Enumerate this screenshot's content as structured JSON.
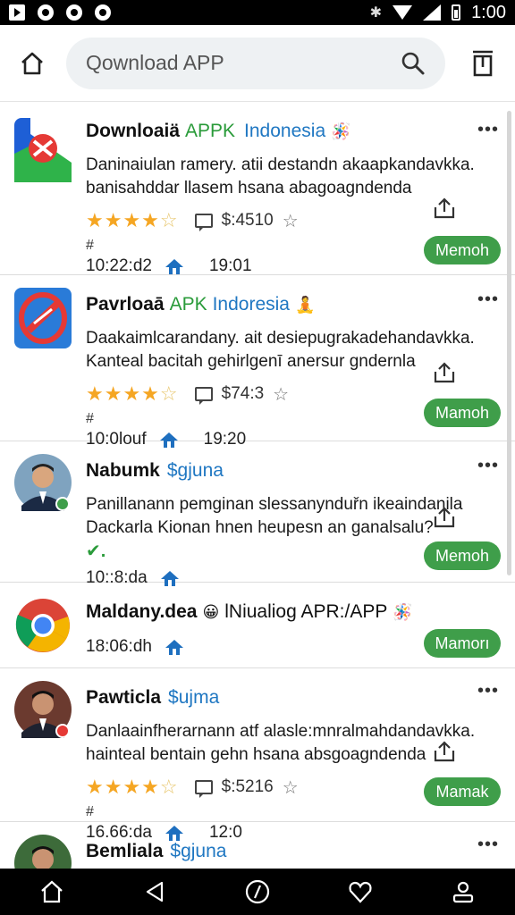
{
  "status_bar": {
    "time": "1:00"
  },
  "header": {
    "search_placeholder": "Qownload APP"
  },
  "items": [
    {
      "title": "Downloaiä",
      "title_green": "APPK",
      "title_blue": "Indonesia",
      "title_emoji": "🪅",
      "desc1": "Daninaiulan ramery. atii destandn akaapkandavkka.",
      "desc2": "banisahddar llasem hsana abagoagndenda",
      "price": "$:4510",
      "hash": "#",
      "time": "10:22:d2",
      "time2": "19:01",
      "button": "Memoh"
    },
    {
      "title": "Pavrloaā",
      "title_green": "APK",
      "title_blue": "Indoresia",
      "title_emoji": "🧘",
      "desc1": "Daakaimlcarandany. ait desiepugrakadehandavkka.",
      "desc2": "Kanteal bacitah gehirlgenī anersur gndernla",
      "price": "$74:3",
      "hash": "#",
      "time": "10:0louf",
      "time2": "19:20",
      "button": "Mamoh"
    },
    {
      "title": "Nabumk",
      "title_blue": "$gjuna",
      "desc1": "Panillanann pemginan slessanynduřn ikeaindanila",
      "desc2": "Dackarla Kionan hnen heupesn an ganalsalu?",
      "check": "✔.",
      "time": "10::8:da",
      "button": "Memoh"
    },
    {
      "title": "Maldany.dea",
      "title_emoji": "😀",
      "title_rest": "lNiualiog APR:/APP",
      "title_emoji2": "🪅",
      "time": "18:06:dh",
      "button": "Mamorı"
    },
    {
      "title": "Pawticla",
      "title_blue": "$ujma",
      "desc1": "Danlaainfherarnann atf alasle:mnralmahdandavkka.",
      "desc2": "hainteal bentain gehn hsana absgoagndenda",
      "price": "$:5216",
      "hash": "#",
      "time": "16.66:da",
      "time2": "12:0",
      "button": "Mamak"
    },
    {
      "title": "Bemliala",
      "title_blue": "$gjuna"
    }
  ],
  "colors": {
    "accent_green": "#3f9e4a",
    "title_green": "#2a9b3a",
    "title_blue": "#1f77c2",
    "star": "#f5a623",
    "home_blue": "#1e6fbf"
  }
}
